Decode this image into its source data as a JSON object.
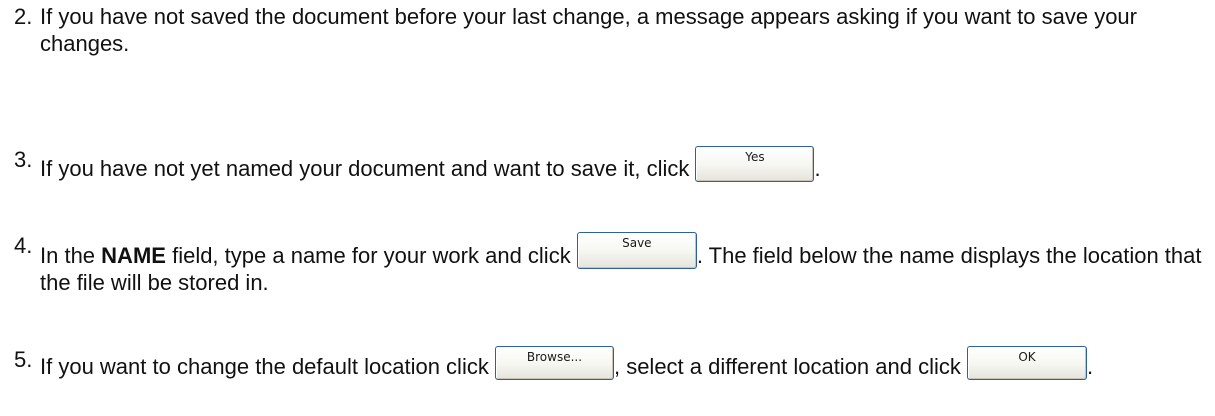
{
  "steps": [
    {
      "number": "2.",
      "text": "If you have not saved the document before your last change, a message appears asking if you want to save your changes."
    },
    {
      "number": "3.",
      "text_before": "If you have not yet named your document and want to save it, click",
      "button_label": "Yes",
      "text_after": "."
    },
    {
      "number": "4.",
      "text_a": "In the",
      "bold_word": "NAME",
      "text_b": "field, type a name for your work and click",
      "button_label": "Save",
      "text_c": ". The field below the name displays the location that the file will be stored in."
    },
    {
      "number": "5.",
      "text_before": "If you want to change the default location click",
      "browse_label": "Browse...",
      "text_middle": ", select a different location and click",
      "ok_label": "OK",
      "text_after": "."
    }
  ]
}
